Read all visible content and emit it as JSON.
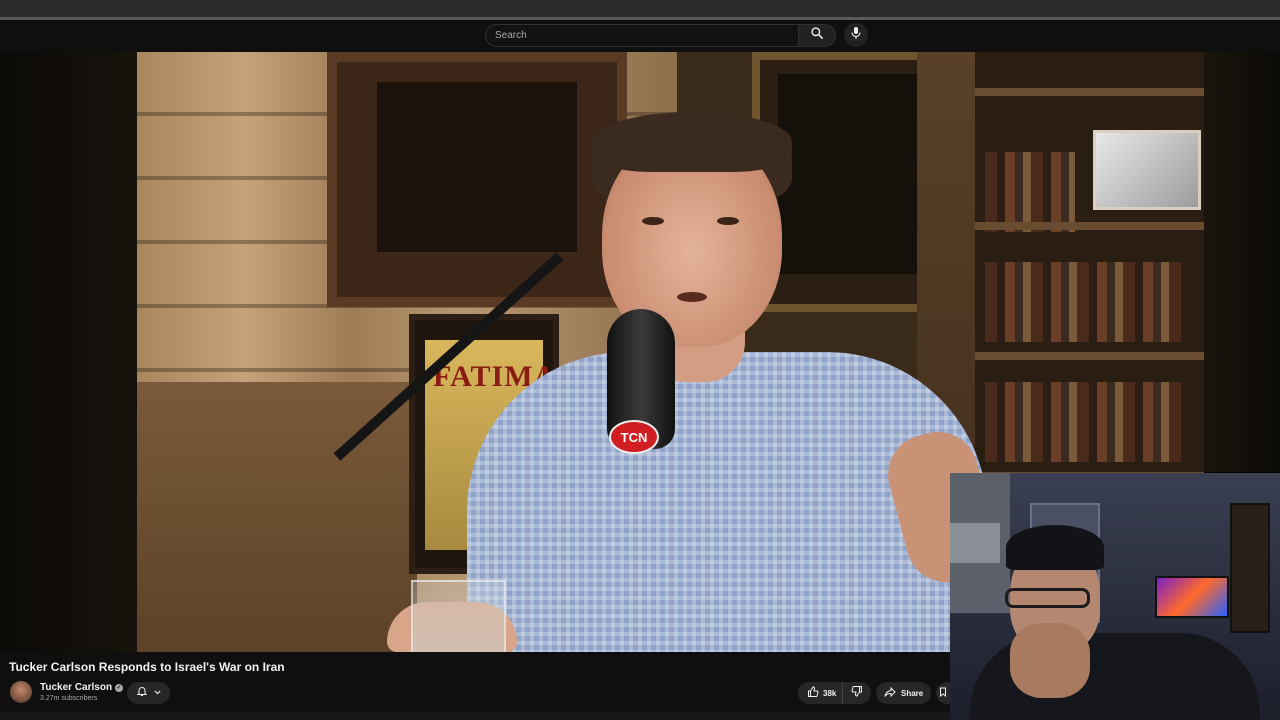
{
  "search": {
    "placeholder": "Search"
  },
  "video": {
    "title": "Tucker Carlson Responds to Israel's War on Iran",
    "poster_text": "FATIMA",
    "mic_badge": "TCN"
  },
  "channel": {
    "name": "Tucker Carlson",
    "subscribers": "3.27m subscribers"
  },
  "actions": {
    "like_count": "38k",
    "share_label": "Share"
  },
  "colors": {
    "background": "#0f0f0f",
    "button_bg": "#272727",
    "text_primary": "#f1f1f1",
    "text_secondary": "#aaaaaa"
  },
  "icons": [
    "search-icon",
    "mic-icon",
    "bell-icon",
    "chevron-down-icon",
    "thumbs-up-icon",
    "thumbs-down-icon",
    "share-icon",
    "verified-icon"
  ]
}
